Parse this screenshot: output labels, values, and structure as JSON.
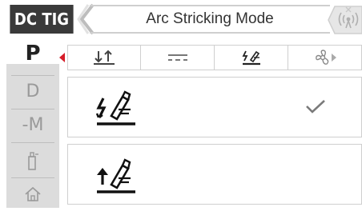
{
  "header": {
    "mode": "DC TIG",
    "title": "Arc Stricking Mode",
    "back_icon": "chevron-left-icon",
    "wireless_icon": "wireless-remote-icon"
  },
  "sidebar": {
    "items": [
      {
        "label": "P",
        "active": true
      },
      {
        "label": "D",
        "active": false
      },
      {
        "label": "-M",
        "active": false
      },
      {
        "label": "",
        "icon": "torch-icon",
        "active": false
      },
      {
        "label": "",
        "icon": "home-icon",
        "active": false
      }
    ]
  },
  "tabs": [
    {
      "icon": "pulse-polarity-icon"
    },
    {
      "icon": "dc-current-icon"
    },
    {
      "icon": "hf-arc-start-icon",
      "active": true
    },
    {
      "icon": "fan-icon"
    }
  ],
  "options": [
    {
      "icon": "hf-arc-start-icon",
      "selected": true
    },
    {
      "icon": "lift-arc-start-icon",
      "selected": false
    }
  ],
  "colors": {
    "badge_bg": "#3a3a3a",
    "accent_red": "#d61e2a",
    "sidebar_bg": "#dcdcdc",
    "check": "#7a7a7a"
  }
}
